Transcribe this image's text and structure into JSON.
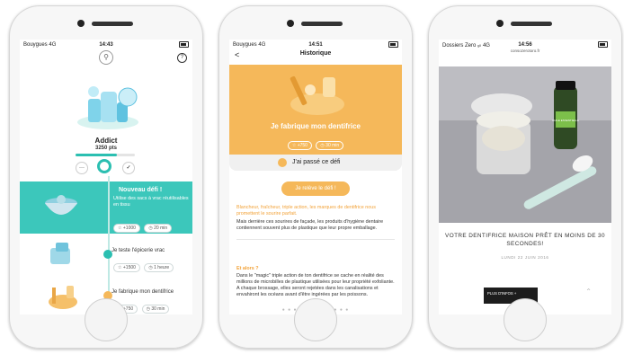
{
  "phones": [
    {
      "status": {
        "carrier": "Bouygues 4G",
        "time": "14:43"
      },
      "header": {
        "help_icon_text": "?"
      },
      "profile": {
        "name": "Addict",
        "points": "3250 pts",
        "progress": 0.7
      },
      "nav": {
        "left": "···",
        "right": "✓"
      },
      "challenge_new": {
        "title": "Nouveau défi !",
        "text": "Utilise des sacs à vrac réutilisables en tissu",
        "points": "+1000",
        "duration": "20 min"
      },
      "challenge_2": {
        "title": "Je teste l'épicerie vrac",
        "points": "+1500",
        "duration": "1 heure"
      },
      "challenge_3": {
        "title": "Je fabrique mon dentifrice",
        "points": "+750",
        "duration": "30 min"
      }
    },
    {
      "status": {
        "carrier": "Bouygues 4G",
        "time": "14:51"
      },
      "nav": {
        "title": "Historique",
        "back": "<"
      },
      "hero": {
        "title": "Je fabrique mon dentifrice",
        "points": "+750",
        "duration": "30 min"
      },
      "done_label": "J'ai passé ce défi",
      "cta": "Je relève le défi !",
      "intro": "Blancheur, fraîcheur, triple action, les marques de dentifrice nous promettent le sourire parfait.",
      "body1": "Mais derrière ces sourires de façade, les produits d'hygiène dentaire contiennent souvent plus de plastique que leur propre emballage.",
      "section": "Et alors ?",
      "body2": "Dans le \"magic\" triple action de ton dentifrice se cache en réalité des millions de microbilles de plastique utilisées pour leur propriété exfoliante. A chaque brossage, elles seront rejetées dans les canalisations et envahiront les océans avant d'être ingérées par les poissons.",
      "pager": "● ● ● ● ● ● ● ● ● ● ● ●"
    },
    {
      "status": {
        "carrier": "Dossiers Zero ᵤₗₗ 4G",
        "time": "14:56",
        "url": "consozerotoro.fr"
      },
      "article": {
        "title": "VOTRE DENTIFRICE MAISON PRÊT EN MOINS DE 30 SECONDES!",
        "date": "LUNDI 22 JUIN 2016",
        "button": "PLUS D'INFOS +",
        "up": "⌃"
      },
      "bottle_label": "HUILE ESSENTIELLE"
    }
  ],
  "colors": {
    "teal": "#2bbfb1",
    "orange": "#f5b85a"
  }
}
